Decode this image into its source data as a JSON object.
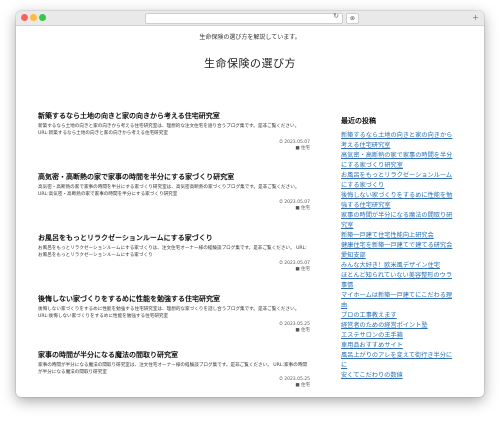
{
  "browser": {
    "reload_glyph": "↻",
    "stop_glyph": "⊗",
    "newtab_glyph": "+"
  },
  "site": {
    "tagline": "生命保険の選び方を解説しています。",
    "title": "生命保険の選び方"
  },
  "articles": [
    {
      "title": "新築するなら土地の向きと家の向きから考える住宅研究室",
      "body": "新築するなら土地の向きと家の向きから考える住宅研究室は、理想的な注文住宅を語り合うブログ集です。是非ご覧ください。 URL:新築するなら土地の向きと家の向きから考える住宅研究室",
      "date": "⏱ 2023.05.07",
      "cat": "■ 住宅"
    },
    {
      "title": "高気密・高断熱の家で家事の時間を半分にする家づくり研究室",
      "body": "高気密・高断熱の家で家事の時間を半分にする家づくり研究室は、高気密高断熱の家づくりブログ集です。是非ご覧ください。 URL:高気密・高断熱の家で家事の時間を半分にする家づくり研究室",
      "date": "⏱ 2023.05.07",
      "cat": "■ 住宅"
    },
    {
      "title": "お風呂をもっとリラクゼーションルームにする家づくり",
      "body": "お風呂をもっとリラクゼーションルームにする家づくりは、注文住宅オーナー様の経験談ブログ集です。是非ご覧ください。 URL:お風呂をもっとリラクゼーションルームにする家づくり",
      "date": "⏱ 2023.05.07",
      "cat": "■ 住宅"
    },
    {
      "title": "後悔しない家づくりをするめに性能を勉強する住宅研究室",
      "body": "後悔しない家づくりをするめに性能を勉強する住宅研究室は、理想的な家づくりを話し合うブログ集です。是非ご覧ください。 URL:後悔しない家づくりをするめに性能を勉強する住宅研究室",
      "date": "⏱ 2023.05.25",
      "cat": "■ 住宅"
    },
    {
      "title": "家事の時間が半分になる魔法の間取り研究室",
      "body": "家事の時間が半分になる魔法の間取り研究室は、注文住宅オーナー様の経験談ブログ集です。是非ご覧ください。 URL:家事の時間が半分になる魔法の間取り研究室",
      "date": "⏱ 2023.05.25",
      "cat": "■ 住宅"
    }
  ],
  "sidebar": {
    "heading": "最近の投稿",
    "links": [
      "新築するなら土地の向きと家の向きから",
      "考える住宅研究室",
      "高気密・高断熱の家で家事の時間を半分",
      "にする家づくり研究室",
      "お風呂をもっとリラクゼーションルーム",
      "にする家づくり",
      "後悔しない家づくりをするめに性能を勉",
      "強する住宅研究室",
      "家事の時間が半分になる魔法の間取り研",
      "究室",
      "新築一戸建て住宅性能向上研究会",
      "健康住宅を新築一戸建てで建てる研究会",
      "愛知支部",
      "みんな大好き！欧米風デザイン住宅",
      "ほとんど知られていない美容整形のウラ",
      "事情",
      "マイホームは新築一戸建てにこだわる理",
      "由",
      "プロの工事教えます",
      "経営者のための経営ポイント塾",
      "エステサロンの王手箱",
      "車用品おすすめサイト",
      "風呂上がりのアレを変えて街行き半分に",
      "に",
      "安くてこだわりの数値"
    ]
  }
}
